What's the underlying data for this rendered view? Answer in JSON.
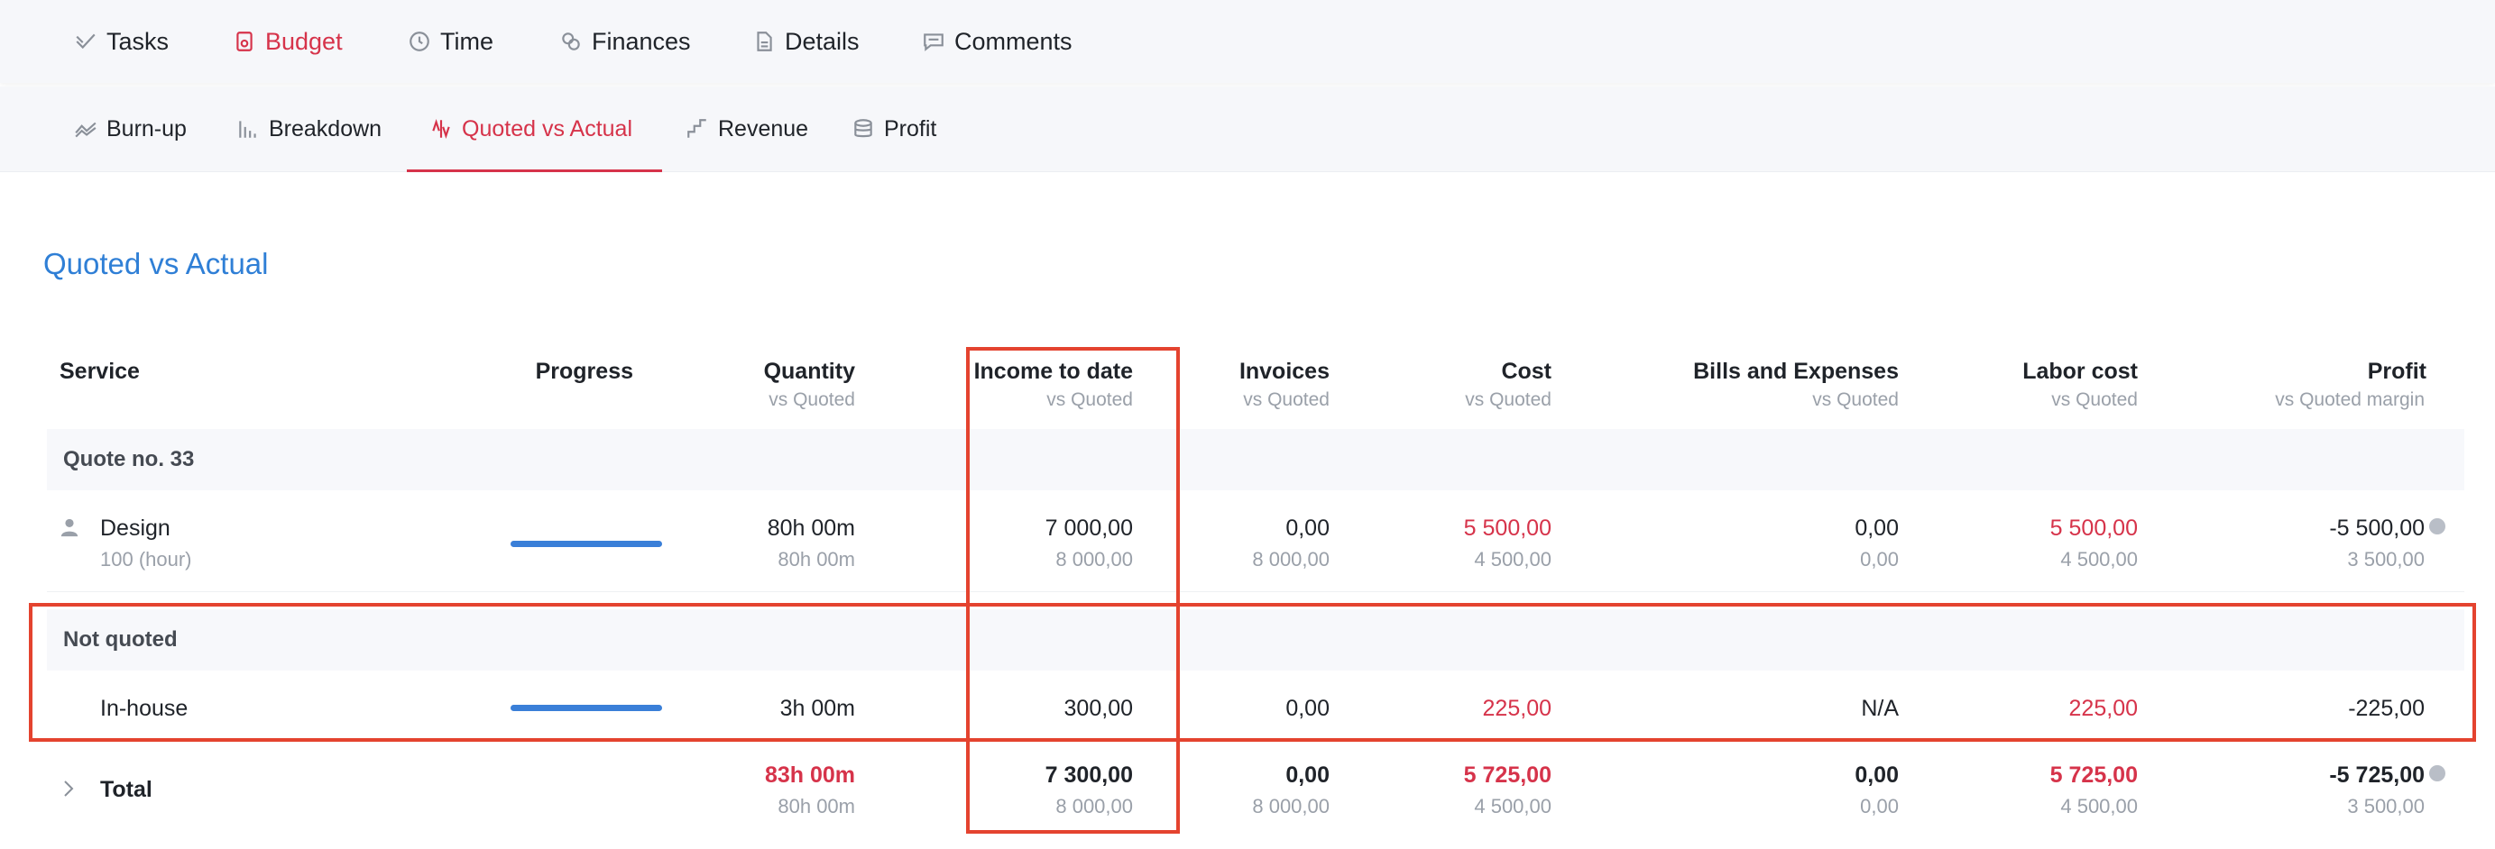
{
  "nav": {
    "tabs": [
      {
        "label": "Tasks",
        "icon": "check-icon"
      },
      {
        "label": "Budget",
        "icon": "budget-icon",
        "active": true
      },
      {
        "label": "Time",
        "icon": "clock-icon"
      },
      {
        "label": "Finances",
        "icon": "coins-icon"
      },
      {
        "label": "Details",
        "icon": "document-icon"
      },
      {
        "label": "Comments",
        "icon": "comment-icon"
      }
    ]
  },
  "subnav": {
    "tabs": [
      {
        "label": "Burn-up",
        "icon": "burnup-icon"
      },
      {
        "label": "Breakdown",
        "icon": "bars-icon"
      },
      {
        "label": "Quoted vs Actual",
        "icon": "compare-icon",
        "active": true
      },
      {
        "label": "Revenue",
        "icon": "revenue-icon"
      },
      {
        "label": "Profit",
        "icon": "stack-coins-icon"
      }
    ]
  },
  "page": {
    "title": "Quoted vs Actual"
  },
  "table": {
    "headers": {
      "service": "Service",
      "progress": "Progress",
      "quantity": "Quantity",
      "quantity_sub": "vs Quoted",
      "income": "Income to date",
      "income_sub": "vs Quoted",
      "invoices": "Invoices",
      "invoices_sub": "vs Quoted",
      "cost": "Cost",
      "cost_sub": "vs Quoted",
      "bills": "Bills and Expenses",
      "bills_sub": "vs Quoted",
      "labor": "Labor cost",
      "labor_sub": "vs Quoted",
      "profit": "Profit",
      "profit_sub": "vs Quoted margin"
    },
    "groups": [
      {
        "label": "Quote no. 33",
        "rows": [
          {
            "name": "Design",
            "sub": "100 (hour)",
            "progress": 1.0,
            "quantity": "80h 00m",
            "quantity_q": "80h 00m",
            "income": "7 000,00",
            "income_q": "8 000,00",
            "invoices": "0,00",
            "invoices_q": "8 000,00",
            "cost": "5 500,00",
            "cost_q": "4 500,00",
            "bills": "0,00",
            "bills_q": "0,00",
            "labor": "5 500,00",
            "labor_q": "4 500,00",
            "profit": "-5 500,00",
            "profit_q": "3 500,00"
          }
        ]
      },
      {
        "label": "Not quoted",
        "rows": [
          {
            "name": "In-house",
            "progress": 1.0,
            "quantity": "3h 00m",
            "income": "300,00",
            "invoices": "0,00",
            "cost": "225,00",
            "bills": "N/A",
            "labor": "225,00",
            "profit": "-225,00"
          }
        ]
      }
    ],
    "total": {
      "label": "Total",
      "quantity": "83h 00m",
      "quantity_q": "80h 00m",
      "income": "7 300,00",
      "income_q": "8 000,00",
      "invoices": "0,00",
      "invoices_q": "8 000,00",
      "cost": "5 725,00",
      "cost_q": "4 500,00",
      "bills": "0,00",
      "bills_q": "0,00",
      "labor": "5 725,00",
      "labor_q": "4 500,00",
      "profit": "-5 725,00",
      "profit_q": "3 500,00"
    }
  },
  "colors": {
    "accent_red": "#d6334a",
    "link_blue": "#2f7fd6",
    "highlight": "#e4432f"
  }
}
